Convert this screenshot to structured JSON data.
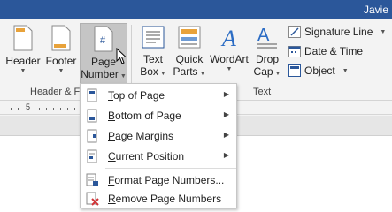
{
  "titlebar": {
    "user": "Javie"
  },
  "ribbon": {
    "header": {
      "label": "Header"
    },
    "footer": {
      "label": "Footer"
    },
    "page_number": {
      "line1": "Page",
      "line2": "Number"
    },
    "group_header_footer": "Header & F",
    "text_box": {
      "line1": "Text",
      "line2": "Box"
    },
    "quick_parts": {
      "line1": "Quick",
      "line2": "Parts"
    },
    "wordart": {
      "label": "WordArt"
    },
    "drop_cap": {
      "line1": "Drop",
      "line2": "Cap"
    },
    "signature_line": "Signature Line",
    "date_time": "Date & Time",
    "object": "Object",
    "group_text": "Text"
  },
  "ruler": {
    "mark": "5"
  },
  "menu": {
    "items": [
      {
        "label": "Top of Page",
        "ul": "T",
        "rest": "op of Page",
        "submenu": true
      },
      {
        "label": "Bottom of Page",
        "ul": "B",
        "rest": "ottom of Page",
        "submenu": true
      },
      {
        "label": "Page Margins",
        "ul": "P",
        "rest": "age Margins",
        "submenu": true
      },
      {
        "label": "Current Position",
        "ul": "C",
        "rest": "urrent Position",
        "submenu": true
      },
      {
        "label": "Format Page Numbers...",
        "ul": "F",
        "rest": "ormat Page Numbers...",
        "submenu": false
      },
      {
        "label": "Remove Page Numbers",
        "ul": "R",
        "rest": "emove Page Numbers",
        "submenu": false
      }
    ]
  },
  "colors": {
    "title_bar": "#2b579a",
    "active_button": "#c5c5c5",
    "accent_blue": "#2b579a"
  }
}
